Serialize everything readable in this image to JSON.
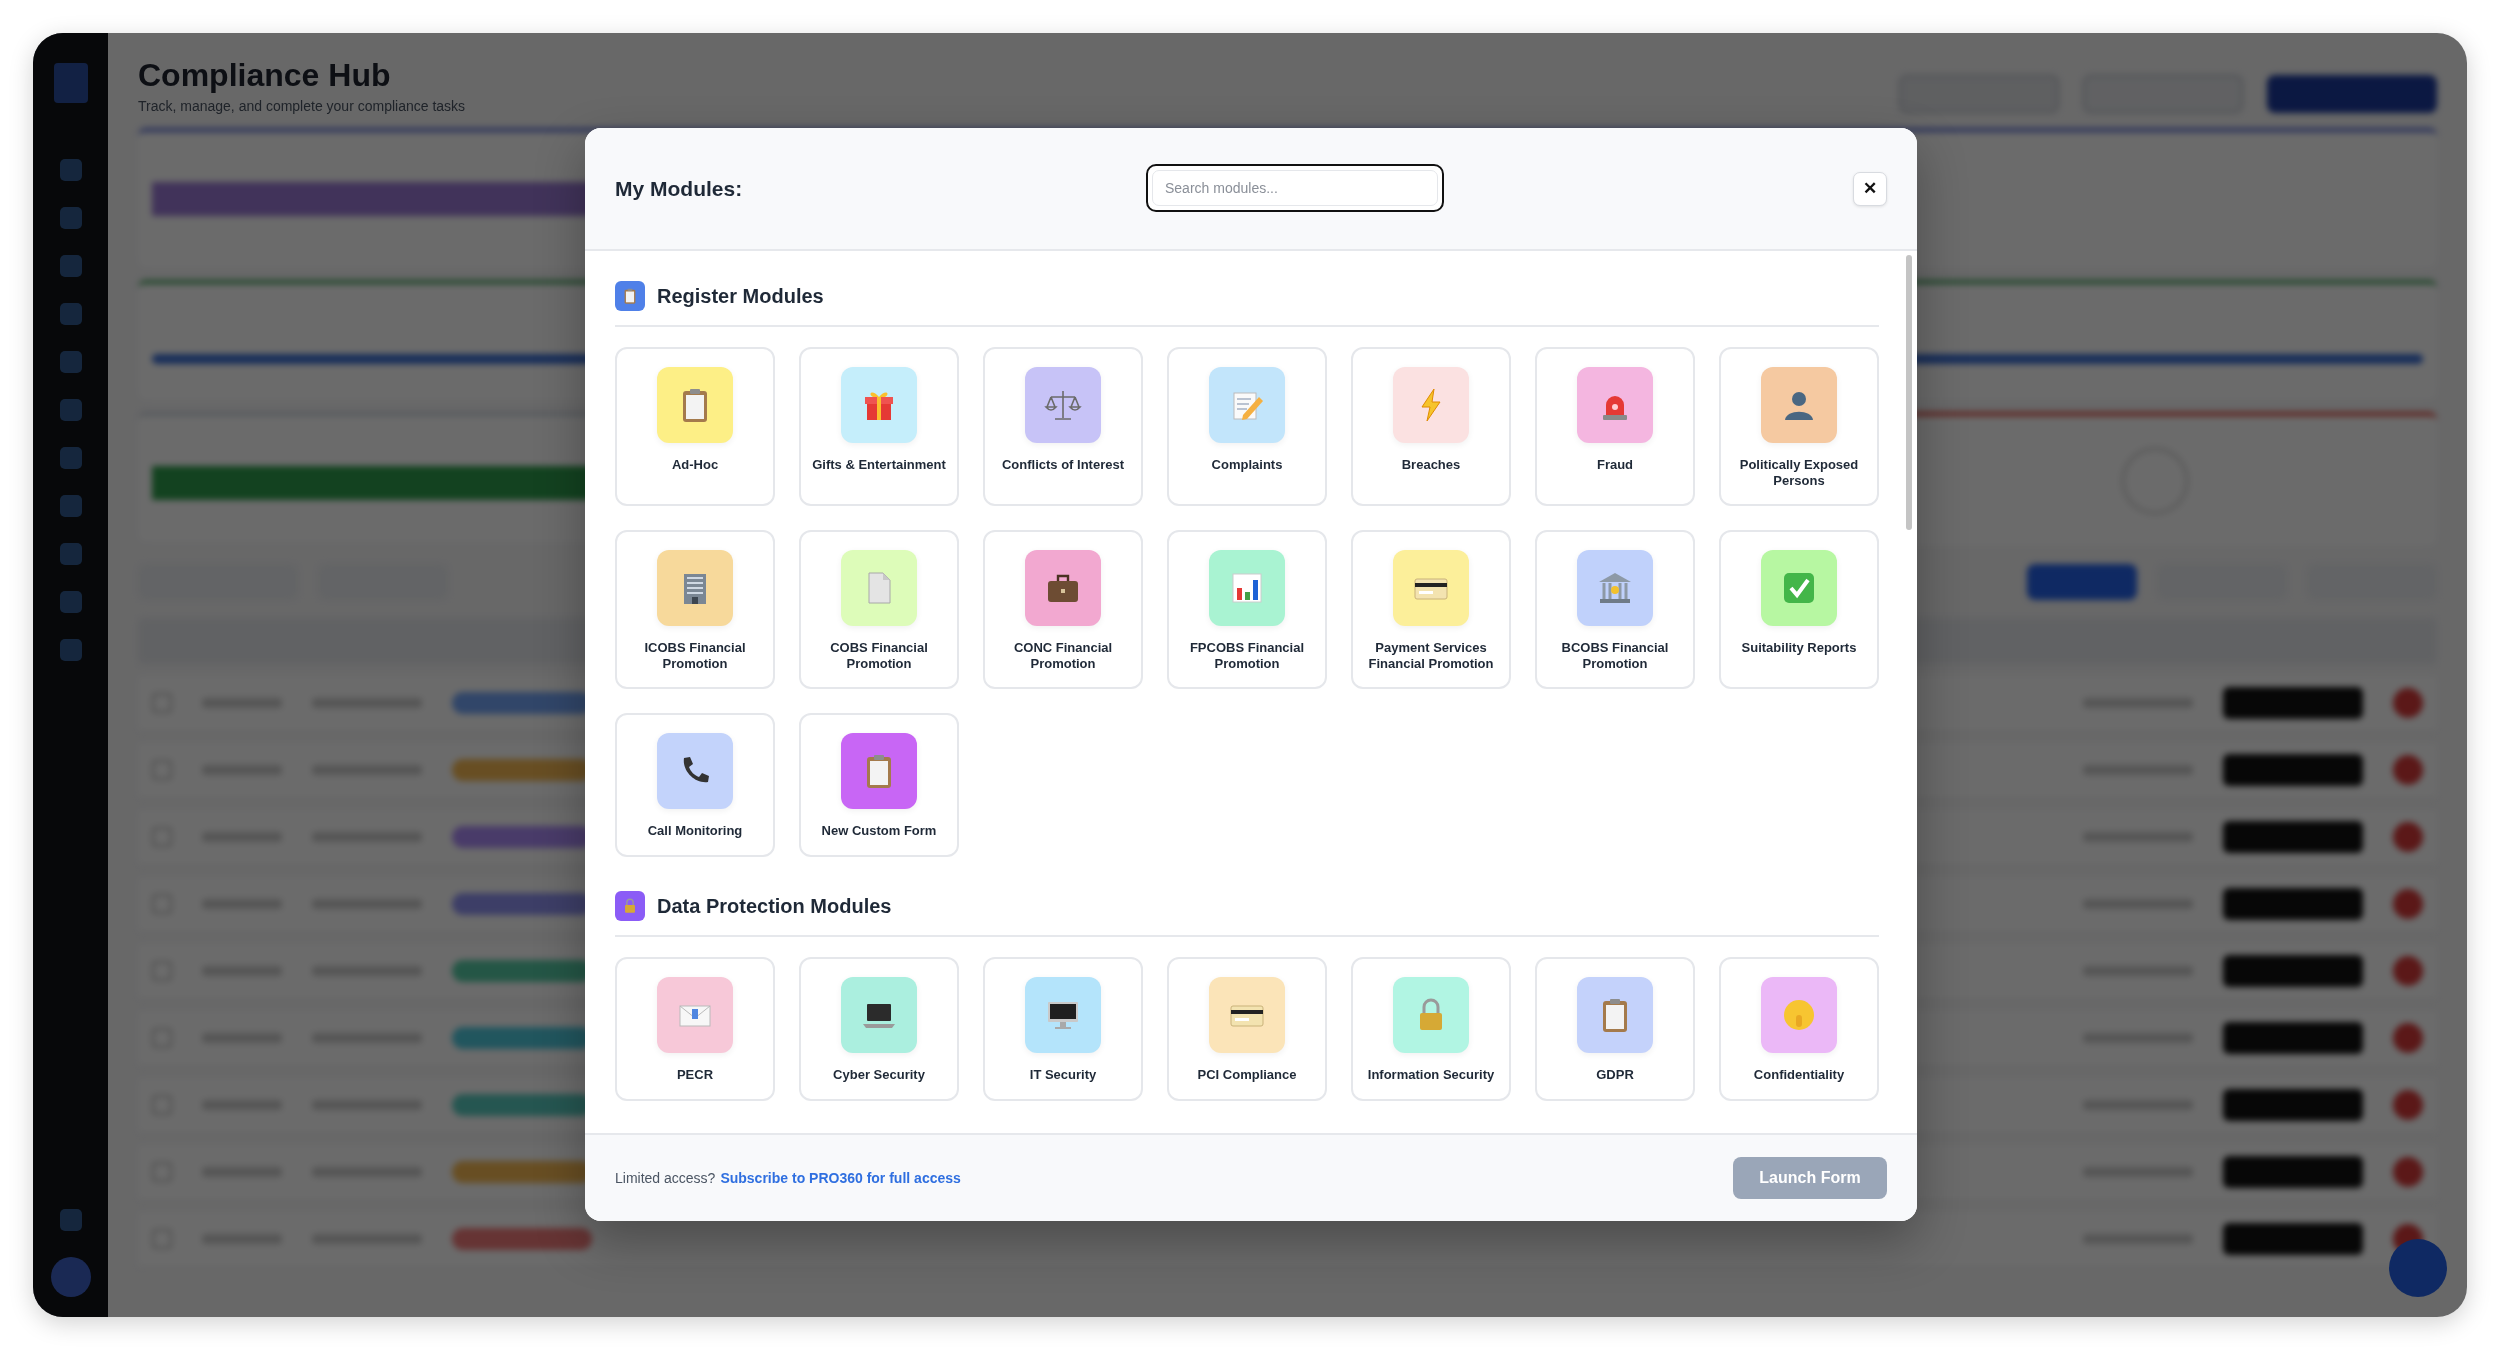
{
  "page": {
    "title": "Compliance Hub",
    "subtitle": "Track, manage, and complete your compliance tasks"
  },
  "modal": {
    "title": "My Modules:",
    "search": {
      "placeholder": "Search modules..."
    },
    "close": "✕",
    "sections": [
      {
        "title": "Register Modules",
        "color": "#4f80e8",
        "modules": [
          {
            "label": "Ad-Hoc",
            "color": "#fdef86"
          },
          {
            "label": "Gifts & Entertainment",
            "color": "#c5eefb"
          },
          {
            "label": "Conflicts of Interest",
            "color": "#c7c3f7"
          },
          {
            "label": "Complaints",
            "color": "#c2e5fb"
          },
          {
            "label": "Breaches",
            "color": "#fbe1e1"
          },
          {
            "label": "Fraud",
            "color": "#f4b6e0"
          },
          {
            "label": "Politically Exposed Persons",
            "color": "#f5c9a1"
          },
          {
            "label": "ICOBS Financial Promotion",
            "color": "#f7d99b"
          },
          {
            "label": "COBS Financial Promotion",
            "color": "#ddfcb9"
          },
          {
            "label": "CONC Financial Promotion",
            "color": "#f2a8d0"
          },
          {
            "label": "FPCOBS Financial Promotion",
            "color": "#a9f3d2"
          },
          {
            "label": "Payment Services Financial Promotion",
            "color": "#fcef9a"
          },
          {
            "label": "BCOBS Financial Promotion",
            "color": "#c0d1fb"
          },
          {
            "label": "Suitability Reports",
            "color": "#b7f7a2"
          },
          {
            "label": "Call Monitoring",
            "color": "#c3d3fb"
          },
          {
            "label": "New Custom Form",
            "color": "#c866f5"
          }
        ]
      },
      {
        "title": "Data Protection Modules",
        "color": "#8b5cf6",
        "modules": [
          {
            "label": "PECR",
            "color": "#f7c8d8"
          },
          {
            "label": "Cyber Security",
            "color": "#abefdf"
          },
          {
            "label": "IT Security",
            "color": "#b4e4fb"
          },
          {
            "label": "PCI Compliance",
            "color": "#fbe4b8"
          },
          {
            "label": "Information Security",
            "color": "#b1f5e3"
          },
          {
            "label": "GDPR",
            "color": "#c4d2fb"
          },
          {
            "label": "Confidentiality",
            "color": "#ebb8f7"
          }
        ]
      }
    ],
    "footer": {
      "note": "Limited access?",
      "link": "Subscribe to PRO360 for full access"
    },
    "launch": {
      "label": "Launch Form",
      "disabled": true
    }
  }
}
